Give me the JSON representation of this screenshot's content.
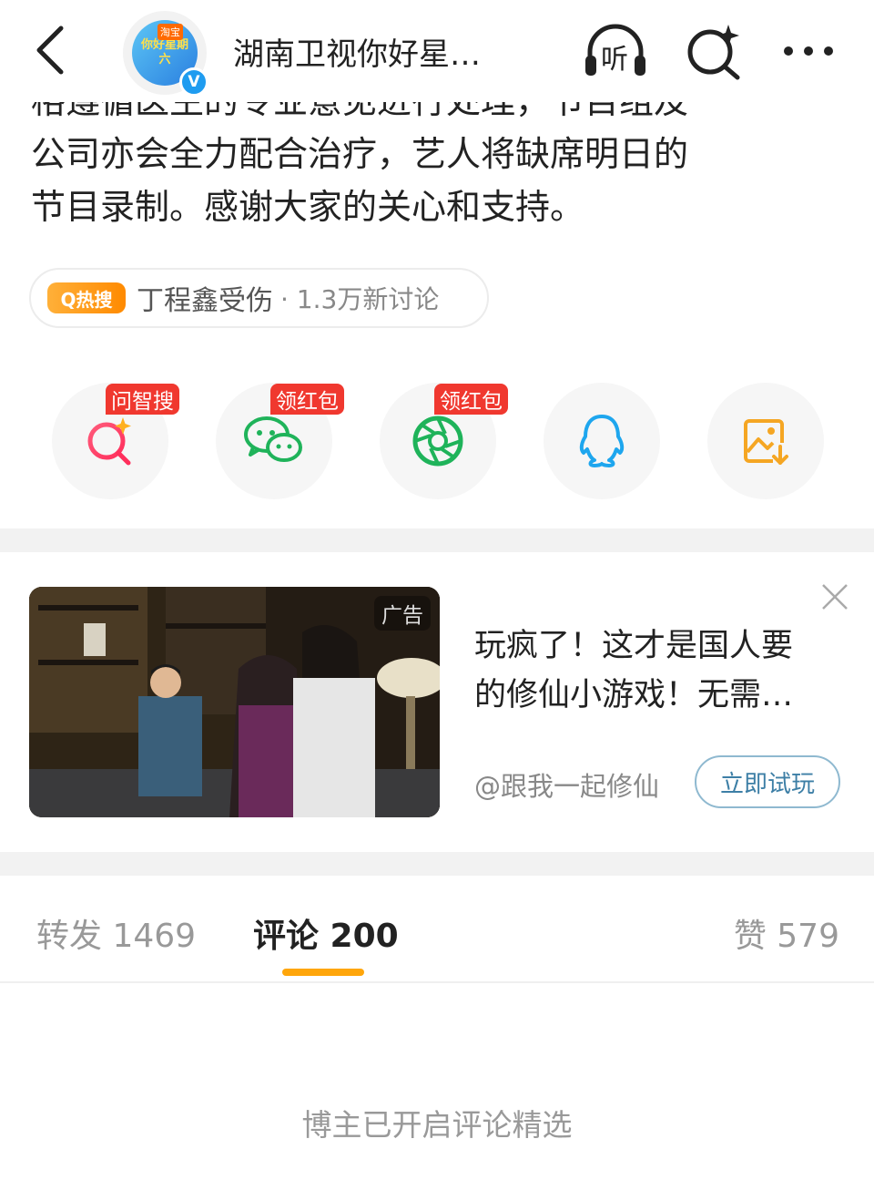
{
  "header": {
    "title": "湖南卫视你好星…",
    "avatar_tag": "淘宝",
    "avatar_text": "你好星期六",
    "verified_mark": "V",
    "icons": [
      "back-icon",
      "listen-icon",
      "ai-search-icon",
      "more-icon"
    ],
    "listen_label": "听"
  },
  "post": {
    "line1": "格遵循医生的专业意见进行处理，节目组及",
    "line2": "公司亦会全力配合治疗，艺人将缺席明日的",
    "line3": "节目录制。感谢大家的关心和支持。"
  },
  "hot_search": {
    "badge": "Q热搜",
    "topic": "丁程鑫受伤",
    "meta": "· 1.3万新讨论",
    "badge_color": "#ff9a1a"
  },
  "share": {
    "items": [
      {
        "icon": "ai-search-icon",
        "badge": "问智搜",
        "color": "#f0382f"
      },
      {
        "icon": "wechat-icon",
        "badge": "领红包",
        "color": "#1fb35a"
      },
      {
        "icon": "moments-icon",
        "badge": "领红包",
        "color": "#1fb35a"
      },
      {
        "icon": "qq-icon",
        "badge": "",
        "color": "#1ea6ee"
      },
      {
        "icon": "save-image-icon",
        "badge": "",
        "color": "#f5a623"
      }
    ]
  },
  "ad": {
    "label": "广告",
    "title_line1": "玩疯了！这才是国人要",
    "title_line2": "的修仙小游戏！无需…",
    "source": "@跟我一起修仙",
    "cta": "立即试玩"
  },
  "tabs": {
    "repost": "转发 1469",
    "comment": "评论 200",
    "like": "赞 579",
    "accent": "#ffa60b"
  },
  "notice": "博主已开启评论精选"
}
